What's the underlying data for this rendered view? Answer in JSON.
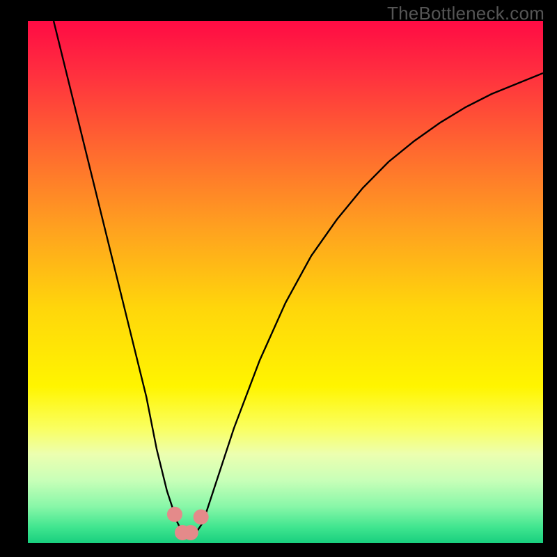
{
  "watermark": "TheBottleneck.com",
  "chart_data": {
    "type": "line",
    "title": "",
    "xlabel": "",
    "ylabel": "",
    "xlim": [
      0,
      100
    ],
    "ylim": [
      0,
      100
    ],
    "background_gradient": {
      "stops": [
        {
          "offset": 0.0,
          "color": "#ff0b44"
        },
        {
          "offset": 0.1,
          "color": "#ff2f3f"
        },
        {
          "offset": 0.25,
          "color": "#ff6a2f"
        },
        {
          "offset": 0.4,
          "color": "#ffa21f"
        },
        {
          "offset": 0.55,
          "color": "#ffd60b"
        },
        {
          "offset": 0.7,
          "color": "#fff500"
        },
        {
          "offset": 0.78,
          "color": "#faff60"
        },
        {
          "offset": 0.83,
          "color": "#ecffb0"
        },
        {
          "offset": 0.88,
          "color": "#c8ffb8"
        },
        {
          "offset": 0.93,
          "color": "#88f7a8"
        },
        {
          "offset": 0.97,
          "color": "#40e58f"
        },
        {
          "offset": 1.0,
          "color": "#18cf7e"
        }
      ]
    },
    "series": [
      {
        "name": "bottleneck-curve",
        "color": "#000000",
        "x": [
          5,
          8,
          11,
          14,
          17,
          20,
          23,
          25,
          27,
          29,
          30.5,
          32,
          34,
          36,
          40,
          45,
          50,
          55,
          60,
          65,
          70,
          75,
          80,
          85,
          90,
          95,
          100
        ],
        "y": [
          100,
          88,
          76,
          64,
          52,
          40,
          28,
          18,
          10,
          4,
          1,
          1,
          4,
          10,
          22,
          35,
          46,
          55,
          62,
          68,
          73,
          77,
          80.5,
          83.5,
          86,
          88,
          90
        ]
      }
    ],
    "markers": {
      "name": "highlight-dots",
      "color": "#e48a8a",
      "radius_px": 11,
      "points": [
        {
          "x": 28.5,
          "y": 5.5
        },
        {
          "x": 30.0,
          "y": 2.0
        },
        {
          "x": 31.6,
          "y": 2.0
        },
        {
          "x": 33.6,
          "y": 5.0
        }
      ]
    }
  }
}
